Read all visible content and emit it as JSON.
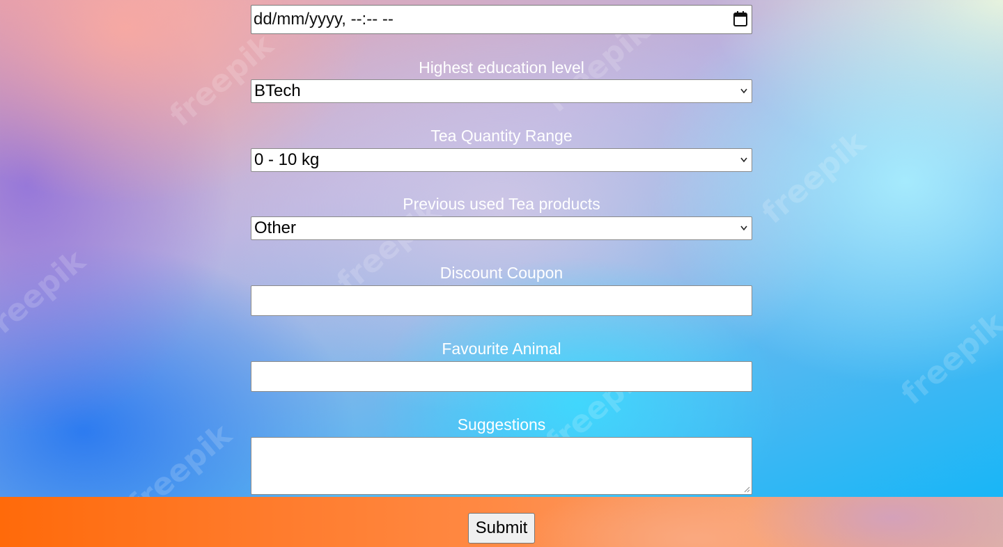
{
  "background": {
    "watermark_text": "freepik"
  },
  "form": {
    "date_field": {
      "value": "dd/mm/yyyy, --:-- --",
      "icon": "calendar-icon"
    },
    "education": {
      "label": "Highest education level",
      "selected": "BTech",
      "icon": "chevron-down-icon"
    },
    "tea_quantity": {
      "label": "Tea Quantity Range",
      "selected": "0 - 10 kg",
      "icon": "chevron-down-icon"
    },
    "previous_products": {
      "label": "Previous used Tea products",
      "selected": "Other",
      "icon": "chevron-down-icon"
    },
    "discount_coupon": {
      "label": "Discount Coupon",
      "value": ""
    },
    "favourite_animal": {
      "label": "Favourite Animal",
      "value": ""
    },
    "suggestions": {
      "label": "Suggestions",
      "value": ""
    }
  },
  "footer": {
    "submit_label": "Submit"
  },
  "colors": {
    "label_text": "#ffffff",
    "footer_accent": "#ff6a0a"
  }
}
